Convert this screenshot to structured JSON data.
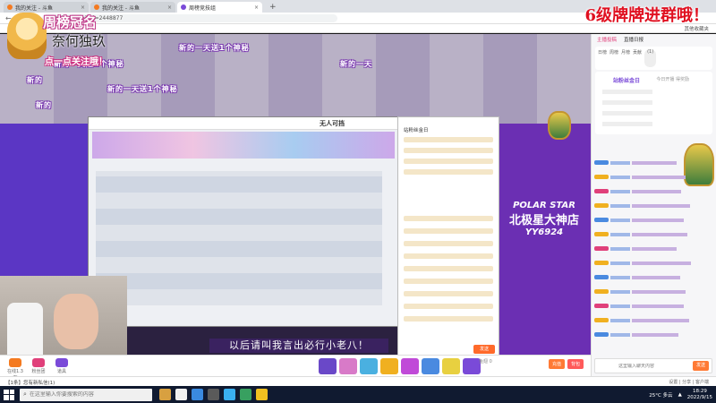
{
  "browser": {
    "tabs": [
      {
        "label": "我的关注 - 斗鱼",
        "fav": "#f47a20",
        "active": false
      },
      {
        "label": "我的关注 - 斗鱼",
        "fav": "#f47a20",
        "active": false
      },
      {
        "label": "周榜竞技组",
        "fav": "#7a4ad8",
        "active": true
      }
    ],
    "url": "...topic/ybddp?rid=2448877",
    "bookmark_right": "其他收藏夹"
  },
  "overlay": {
    "level_text": "6级牌牌进群哦！",
    "rank": "周榜冠名",
    "name": "奈何独玖",
    "follow": "点一点关注哦！"
  },
  "stream": {
    "danmu": [
      "新的一天送1个神秘",
      "新的一天送1个神秘",
      "新的一天",
      "新的",
      "新的一天送1个神秘",
      "新的"
    ],
    "polar_line1": "POLAR STAR",
    "polar_line2": "北极星大神店",
    "polar_line3": "YY6924",
    "caption": "以后请叫我言出必行小老八！",
    "inner_logo": "无人可挡",
    "inner_chat_title": "站粉丝金日",
    "inner_send": "发送"
  },
  "giftbar": {
    "left_items": [
      {
        "label": "在线1.3万",
        "color": "#f47a20"
      },
      {
        "label": "粉丝团",
        "color": "#e0407a"
      },
      {
        "label": "道具",
        "color": "#7a4ad8"
      }
    ],
    "gift_colors": [
      "#6a48c8",
      "#d87ac8",
      "#4ab0e0",
      "#f0b020",
      "#c04ad8",
      "#4a8ae0",
      "#e8d040",
      "#7a4ad8",
      "#4ab0e0",
      "#e08030",
      "#5ad0e0",
      "#f0c040",
      "#e04a4a",
      "#4ac0e0",
      "#f0a020",
      "#3a9ae0"
    ],
    "gift_label": "鱼丸 384",
    "pay_label": "鱼翅 0",
    "pay_buttons": [
      {
        "label": "充值",
        "color": "#ff7a35"
      },
      {
        "label": "背包",
        "color": "#ff5a5a"
      }
    ]
  },
  "sidebar": {
    "tabs": [
      "主播投稿",
      "直播日报"
    ],
    "rank_items": [
      "日榜",
      "周榜",
      "月榜",
      "贡献",
      "(1)"
    ],
    "fan_title": "站粉丝金日",
    "fan_right": "今日开播 得奖励",
    "input_placeholder": "这里输入聊天内容",
    "send_label": "发送"
  },
  "notif": {
    "text": "【1条】您有新私信(1)",
    "right": "设置 | 分享 | 客户端"
  },
  "taskbar": {
    "search_placeholder": "在这里输入你要搜索的内容",
    "app_colors": [
      "#d8a040",
      "#f0f0f0",
      "#3a8ae0",
      "#5a5a5a",
      "#3ab0f0",
      "#38a060",
      "#f0c020"
    ],
    "weather": "25°C 多云",
    "time": "18:29",
    "date": "2022/9/15"
  }
}
